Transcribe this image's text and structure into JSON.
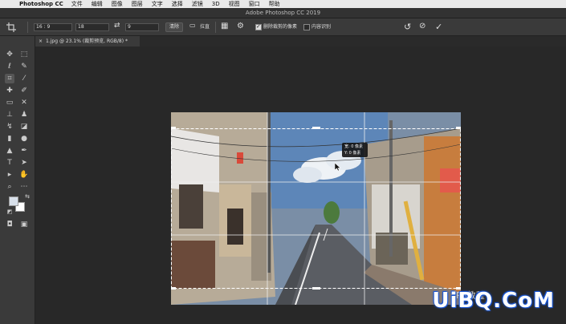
{
  "menubar": {
    "app": "Photoshop CC",
    "items": [
      "文件",
      "编辑",
      "图像",
      "图层",
      "文字",
      "选择",
      "滤镜",
      "3D",
      "视图",
      "窗口",
      "帮助"
    ]
  },
  "window": {
    "title": "Adobe Photoshop CC 2019"
  },
  "options": {
    "ratio_value": "16 : 9",
    "width_value": "18",
    "height_value": "9",
    "clear_label": "清除",
    "straighten_label": "拉直",
    "delete_cropped_label": "删除裁剪的像素",
    "content_aware_label": "内容识别"
  },
  "tab": {
    "label": "1.jpg @ 23.1% (裁剪预览, RGB/8) *"
  },
  "tooltip": {
    "width_line": "宽: 0 像素",
    "height_line": "Y: 0 像素"
  },
  "watermark": {
    "text": "UiBQ.CoM",
    "small": "PS教程"
  },
  "colors": {
    "fg": "#d8e0ea",
    "bg": "#ffffff",
    "ui_dark": "#262626",
    "panel": "#3a3a3a"
  }
}
